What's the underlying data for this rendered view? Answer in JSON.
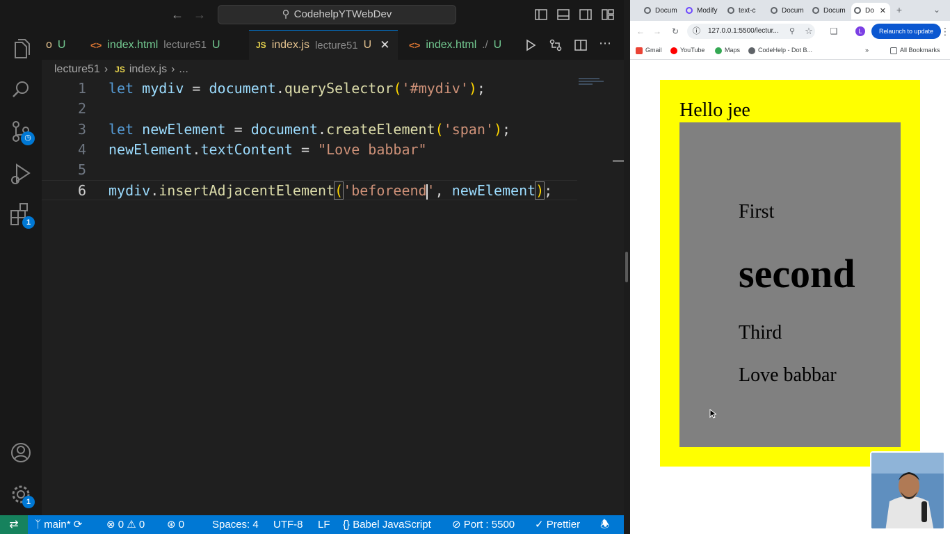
{
  "vscode": {
    "title": "CodehelpYTWebDev",
    "tabs": [
      {
        "label": "U",
        "dir": "",
        "status": ""
      },
      {
        "label": "index.html",
        "dir": "lecture51",
        "status": "U"
      },
      {
        "label": "index.js",
        "dir": "lecture51",
        "status": "U"
      },
      {
        "label": "index.html",
        "dir": "./",
        "status": "U"
      }
    ],
    "breadcrumb": {
      "folder": "lecture51",
      "file": "index.js",
      "more": "..."
    },
    "line_numbers": [
      "1",
      "2",
      "3",
      "4",
      "5",
      "6"
    ],
    "code": {
      "l1": {
        "kw": "let",
        "var": "mydiv",
        "eq": " = ",
        "obj": "document",
        "dot": ".",
        "fn": "querySelector",
        "open": "(",
        "str": "'#mydiv'",
        "close": ")",
        "end": ";"
      },
      "l3": {
        "kw": "let",
        "var": "newElement",
        "eq": " = ",
        "obj": "document",
        "dot": ".",
        "fn": "createElement",
        "open": "(",
        "str": "'span'",
        "close": ")",
        "end": ";"
      },
      "l4": {
        "var": "newElement",
        "dot": ".",
        "prop": "textContent",
        "eq": " = ",
        "str": "\"Love babbar\""
      },
      "l6": {
        "var": "mydiv",
        "dot": ".",
        "fn": "insertAdjacentElement",
        "open": "(",
        "str1": "'beforeend",
        "str2": "'",
        "comma": ", ",
        "arg": "newElement",
        "close": ")",
        "end": ";"
      }
    },
    "activity_badges": {
      "source_control": "",
      "extensions": "1",
      "settings": "1"
    },
    "statusbar": {
      "branch": "main*",
      "errors": "0",
      "warnings": "0",
      "ports": "0",
      "spaces": "Spaces: 4",
      "encoding": "UTF-8",
      "eol": "LF",
      "language": "Babel JavaScript",
      "port": "Port : 5500",
      "formatter": "Prettier"
    }
  },
  "browser": {
    "tabs": [
      "Docum",
      "Modify",
      "text-c",
      "Docum",
      "Docum",
      "Do"
    ],
    "url": "127.0.0.1:5500/lectur...",
    "relaunch": "Relaunch to update",
    "bookmarks": [
      "Gmail",
      "YouTube",
      "Maps",
      "CodeHelp - Dot B...",
      "All Bookmarks"
    ],
    "page": {
      "heading": "Hello jee",
      "items": [
        "First",
        "second",
        "Third",
        "Love babbar"
      ]
    }
  },
  "colors": {
    "accent": "#0078d4",
    "yellow_box": "#ffff00",
    "gray_box": "#808080",
    "remote": "#16825d"
  }
}
